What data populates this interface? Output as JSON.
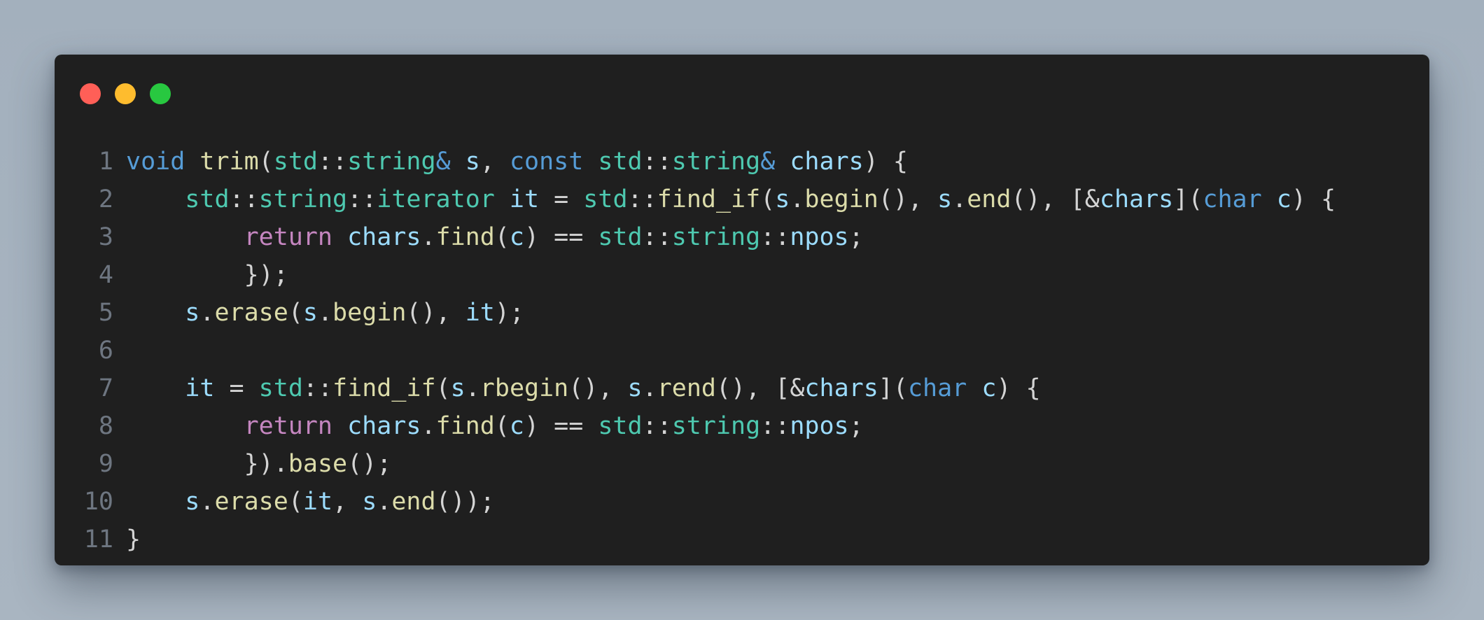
{
  "colors": {
    "background": "#a6b3bf",
    "editor_bg": "#1f1f1f",
    "line_number": "#6e7681",
    "dot_red": "#ff5f57",
    "dot_yellow": "#febc2e",
    "dot_green": "#28c840"
  },
  "window_controls": [
    {
      "name": "close-dot",
      "color": "#ff5f57"
    },
    {
      "name": "minimize-dot",
      "color": "#febc2e"
    },
    {
      "name": "maximize-dot",
      "color": "#28c840"
    }
  ],
  "code_lines": [
    {
      "number": "1",
      "tokens": [
        {
          "t": "void",
          "c": "#569cd6"
        },
        {
          "t": " ",
          "c": "#d4d4d4"
        },
        {
          "t": "trim",
          "c": "#dcdcaa"
        },
        {
          "t": "(",
          "c": "#d4d4d4"
        },
        {
          "t": "std",
          "c": "#4ec9b0"
        },
        {
          "t": "::",
          "c": "#d4d4d4"
        },
        {
          "t": "string",
          "c": "#4ec9b0"
        },
        {
          "t": "&",
          "c": "#569cd6"
        },
        {
          "t": " ",
          "c": "#d4d4d4"
        },
        {
          "t": "s",
          "c": "#9cdcfe"
        },
        {
          "t": ", ",
          "c": "#d4d4d4"
        },
        {
          "t": "const",
          "c": "#569cd6"
        },
        {
          "t": " ",
          "c": "#d4d4d4"
        },
        {
          "t": "std",
          "c": "#4ec9b0"
        },
        {
          "t": "::",
          "c": "#d4d4d4"
        },
        {
          "t": "string",
          "c": "#4ec9b0"
        },
        {
          "t": "&",
          "c": "#569cd6"
        },
        {
          "t": " ",
          "c": "#d4d4d4"
        },
        {
          "t": "chars",
          "c": "#9cdcfe"
        },
        {
          "t": ") {",
          "c": "#d4d4d4"
        }
      ]
    },
    {
      "number": "2",
      "tokens": [
        {
          "t": "    ",
          "c": "#d4d4d4"
        },
        {
          "t": "std",
          "c": "#4ec9b0"
        },
        {
          "t": "::",
          "c": "#d4d4d4"
        },
        {
          "t": "string",
          "c": "#4ec9b0"
        },
        {
          "t": "::",
          "c": "#d4d4d4"
        },
        {
          "t": "iterator",
          "c": "#4ec9b0"
        },
        {
          "t": " ",
          "c": "#d4d4d4"
        },
        {
          "t": "it",
          "c": "#9cdcfe"
        },
        {
          "t": " = ",
          "c": "#d4d4d4"
        },
        {
          "t": "std",
          "c": "#4ec9b0"
        },
        {
          "t": "::",
          "c": "#d4d4d4"
        },
        {
          "t": "find_if",
          "c": "#dcdcaa"
        },
        {
          "t": "(",
          "c": "#d4d4d4"
        },
        {
          "t": "s",
          "c": "#9cdcfe"
        },
        {
          "t": ".",
          "c": "#d4d4d4"
        },
        {
          "t": "begin",
          "c": "#dcdcaa"
        },
        {
          "t": "(), ",
          "c": "#d4d4d4"
        },
        {
          "t": "s",
          "c": "#9cdcfe"
        },
        {
          "t": ".",
          "c": "#d4d4d4"
        },
        {
          "t": "end",
          "c": "#dcdcaa"
        },
        {
          "t": "(), [&",
          "c": "#d4d4d4"
        },
        {
          "t": "chars",
          "c": "#9cdcfe"
        },
        {
          "t": "](",
          "c": "#d4d4d4"
        },
        {
          "t": "char",
          "c": "#569cd6"
        },
        {
          "t": " ",
          "c": "#d4d4d4"
        },
        {
          "t": "c",
          "c": "#9cdcfe"
        },
        {
          "t": ") {",
          "c": "#d4d4d4"
        }
      ]
    },
    {
      "number": "3",
      "tokens": [
        {
          "t": "        ",
          "c": "#d4d4d4"
        },
        {
          "t": "return",
          "c": "#c586c0"
        },
        {
          "t": " ",
          "c": "#d4d4d4"
        },
        {
          "t": "chars",
          "c": "#9cdcfe"
        },
        {
          "t": ".",
          "c": "#d4d4d4"
        },
        {
          "t": "find",
          "c": "#dcdcaa"
        },
        {
          "t": "(",
          "c": "#d4d4d4"
        },
        {
          "t": "c",
          "c": "#9cdcfe"
        },
        {
          "t": ") == ",
          "c": "#d4d4d4"
        },
        {
          "t": "std",
          "c": "#4ec9b0"
        },
        {
          "t": "::",
          "c": "#d4d4d4"
        },
        {
          "t": "string",
          "c": "#4ec9b0"
        },
        {
          "t": "::",
          "c": "#d4d4d4"
        },
        {
          "t": "npos",
          "c": "#9cdcfe"
        },
        {
          "t": ";",
          "c": "#d4d4d4"
        }
      ]
    },
    {
      "number": "4",
      "tokens": [
        {
          "t": "        });",
          "c": "#d4d4d4"
        }
      ]
    },
    {
      "number": "5",
      "tokens": [
        {
          "t": "    ",
          "c": "#d4d4d4"
        },
        {
          "t": "s",
          "c": "#9cdcfe"
        },
        {
          "t": ".",
          "c": "#d4d4d4"
        },
        {
          "t": "erase",
          "c": "#dcdcaa"
        },
        {
          "t": "(",
          "c": "#d4d4d4"
        },
        {
          "t": "s",
          "c": "#9cdcfe"
        },
        {
          "t": ".",
          "c": "#d4d4d4"
        },
        {
          "t": "begin",
          "c": "#dcdcaa"
        },
        {
          "t": "(), ",
          "c": "#d4d4d4"
        },
        {
          "t": "it",
          "c": "#9cdcfe"
        },
        {
          "t": ");",
          "c": "#d4d4d4"
        }
      ]
    },
    {
      "number": "6",
      "tokens": []
    },
    {
      "number": "7",
      "tokens": [
        {
          "t": "    ",
          "c": "#d4d4d4"
        },
        {
          "t": "it",
          "c": "#9cdcfe"
        },
        {
          "t": " = ",
          "c": "#d4d4d4"
        },
        {
          "t": "std",
          "c": "#4ec9b0"
        },
        {
          "t": "::",
          "c": "#d4d4d4"
        },
        {
          "t": "find_if",
          "c": "#dcdcaa"
        },
        {
          "t": "(",
          "c": "#d4d4d4"
        },
        {
          "t": "s",
          "c": "#9cdcfe"
        },
        {
          "t": ".",
          "c": "#d4d4d4"
        },
        {
          "t": "rbegin",
          "c": "#dcdcaa"
        },
        {
          "t": "(), ",
          "c": "#d4d4d4"
        },
        {
          "t": "s",
          "c": "#9cdcfe"
        },
        {
          "t": ".",
          "c": "#d4d4d4"
        },
        {
          "t": "rend",
          "c": "#dcdcaa"
        },
        {
          "t": "(), [&",
          "c": "#d4d4d4"
        },
        {
          "t": "chars",
          "c": "#9cdcfe"
        },
        {
          "t": "](",
          "c": "#d4d4d4"
        },
        {
          "t": "char",
          "c": "#569cd6"
        },
        {
          "t": " ",
          "c": "#d4d4d4"
        },
        {
          "t": "c",
          "c": "#9cdcfe"
        },
        {
          "t": ") {",
          "c": "#d4d4d4"
        }
      ]
    },
    {
      "number": "8",
      "tokens": [
        {
          "t": "        ",
          "c": "#d4d4d4"
        },
        {
          "t": "return",
          "c": "#c586c0"
        },
        {
          "t": " ",
          "c": "#d4d4d4"
        },
        {
          "t": "chars",
          "c": "#9cdcfe"
        },
        {
          "t": ".",
          "c": "#d4d4d4"
        },
        {
          "t": "find",
          "c": "#dcdcaa"
        },
        {
          "t": "(",
          "c": "#d4d4d4"
        },
        {
          "t": "c",
          "c": "#9cdcfe"
        },
        {
          "t": ") == ",
          "c": "#d4d4d4"
        },
        {
          "t": "std",
          "c": "#4ec9b0"
        },
        {
          "t": "::",
          "c": "#d4d4d4"
        },
        {
          "t": "string",
          "c": "#4ec9b0"
        },
        {
          "t": "::",
          "c": "#d4d4d4"
        },
        {
          "t": "npos",
          "c": "#9cdcfe"
        },
        {
          "t": ";",
          "c": "#d4d4d4"
        }
      ]
    },
    {
      "number": "9",
      "tokens": [
        {
          "t": "        }).",
          "c": "#d4d4d4"
        },
        {
          "t": "base",
          "c": "#dcdcaa"
        },
        {
          "t": "();",
          "c": "#d4d4d4"
        }
      ]
    },
    {
      "number": "10",
      "tokens": [
        {
          "t": "    ",
          "c": "#d4d4d4"
        },
        {
          "t": "s",
          "c": "#9cdcfe"
        },
        {
          "t": ".",
          "c": "#d4d4d4"
        },
        {
          "t": "erase",
          "c": "#dcdcaa"
        },
        {
          "t": "(",
          "c": "#d4d4d4"
        },
        {
          "t": "it",
          "c": "#9cdcfe"
        },
        {
          "t": ", ",
          "c": "#d4d4d4"
        },
        {
          "t": "s",
          "c": "#9cdcfe"
        },
        {
          "t": ".",
          "c": "#d4d4d4"
        },
        {
          "t": "end",
          "c": "#dcdcaa"
        },
        {
          "t": "());",
          "c": "#d4d4d4"
        }
      ]
    },
    {
      "number": "11",
      "tokens": [
        {
          "t": "}",
          "c": "#d4d4d4"
        }
      ]
    }
  ]
}
